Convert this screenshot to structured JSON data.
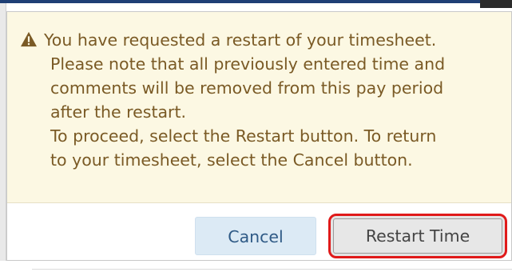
{
  "dialog": {
    "icon": "warning-triangle-icon",
    "message_lines": [
      "You have requested a restart of your timesheet.",
      "Please note that all previously entered time and",
      "comments will be removed from this pay period",
      "after the restart.",
      "To proceed, select the Restart button. To return",
      "to your timesheet, select the Cancel button."
    ],
    "cancel_label": "Cancel",
    "restart_label": "Restart Time"
  },
  "colors": {
    "warning_bg": "#fcf8e3",
    "warning_text": "#7a5a25",
    "cancel_bg": "#dceaf5",
    "cancel_text": "#2f5a86",
    "restart_bg": "#e4e4e4",
    "highlight_outline": "#e01a1a"
  }
}
